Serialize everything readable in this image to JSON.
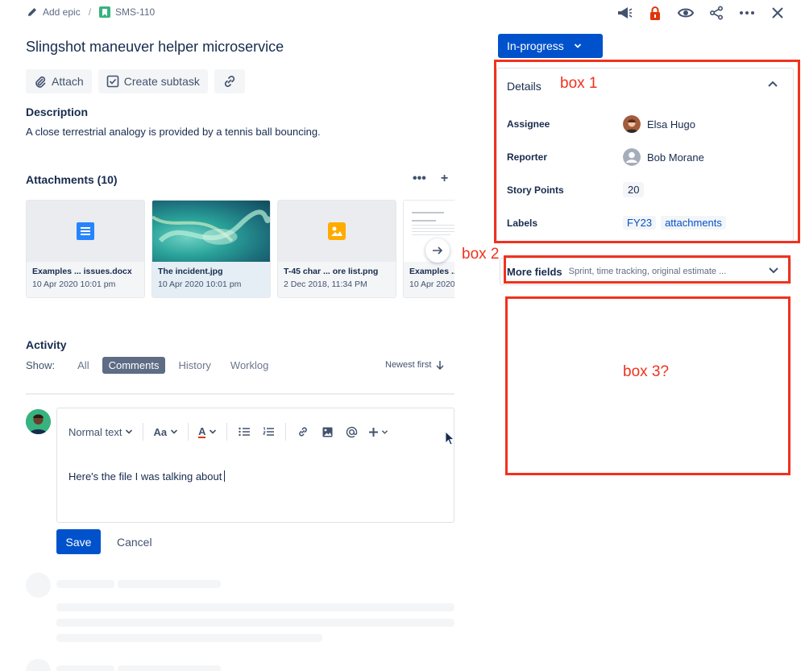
{
  "breadcrumb": {
    "add_epic": "Add epic",
    "separator": "/",
    "issue_key": "SMS-110"
  },
  "top_actions": [
    "megaphone-icon",
    "lock-icon",
    "watch-icon",
    "share-icon",
    "more-icon",
    "close-icon"
  ],
  "issue": {
    "title": "Slingshot maneuver helper microservice",
    "actions": {
      "attach": "Attach",
      "create_subtask": "Create subtask"
    },
    "description_heading": "Description",
    "description": "A close terrestrial analogy is provided by a tennis ball bouncing."
  },
  "attachments": {
    "heading": "Attachments (10)",
    "more": "•••",
    "add": "+",
    "items": [
      {
        "name": "Examples ... issues.docx",
        "date": "10 Apr 2020 10:01 pm",
        "kind": "doc"
      },
      {
        "name": "The incident.jpg",
        "date": "10 Apr 2020 10:01 pm",
        "kind": "photo"
      },
      {
        "name": "T-45 char ... ore list.png",
        "date": "2 Dec 2018, 11:34 PM",
        "kind": "image"
      },
      {
        "name": "Examples ...",
        "date": "10 Apr 2020",
        "kind": "preview"
      }
    ]
  },
  "activity": {
    "heading": "Activity",
    "show_label": "Show:",
    "filters": [
      "All",
      "Comments",
      "History",
      "Worklog"
    ],
    "active_filter": "Comments",
    "sort": "Newest first",
    "editor": {
      "text_style": "Normal text",
      "font_size": "Aa",
      "text_color": "A",
      "body": "Here's the file I was talking about"
    },
    "save": "Save",
    "cancel": "Cancel"
  },
  "sidebar": {
    "status": "In-progress",
    "details": {
      "heading": "Details",
      "assignee_label": "Assignee",
      "assignee": "Elsa Hugo",
      "reporter_label": "Reporter",
      "reporter": "Bob Morane",
      "story_points_label": "Story Points",
      "story_points": "20",
      "labels_label": "Labels",
      "labels": [
        "FY23",
        "attachments"
      ]
    },
    "more_fields": {
      "title": "More fields",
      "subtitle": "Sprint, time tracking, original estimate ..."
    }
  },
  "annotations": {
    "box1": "box 1",
    "box2": "box 2",
    "box3": "box 3?"
  },
  "colors": {
    "primary": "#0052cc",
    "annotation_red": "#f0321e",
    "text": "#172b4d"
  }
}
